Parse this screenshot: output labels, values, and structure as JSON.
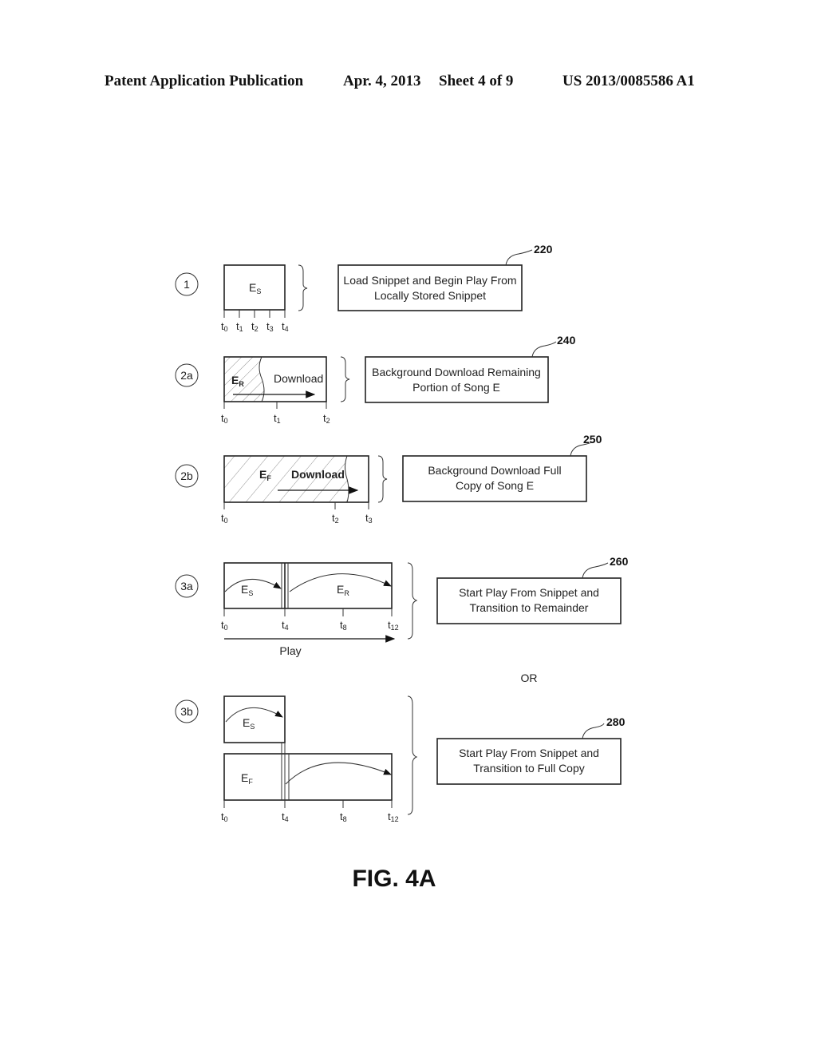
{
  "header": {
    "publication": "Patent Application Publication",
    "date": "Apr. 4, 2013",
    "sheet": "Sheet 4 of 9",
    "number": "US 2013/0085586 A1"
  },
  "figure_label": "FIG. 4A",
  "or_label": "OR",
  "steps": [
    {
      "id": "1",
      "segment_label": "E",
      "segment_sub": "S",
      "ticks": [
        {
          "t": "t",
          "s": "0"
        },
        {
          "t": "t",
          "s": "1"
        },
        {
          "t": "t",
          "s": "2"
        },
        {
          "t": "t",
          "s": "3"
        },
        {
          "t": "t",
          "s": "4"
        }
      ],
      "ref": "220",
      "description_lines": [
        "Load Snippet and Begin Play From",
        "Locally Stored Snippet"
      ]
    },
    {
      "id": "2a",
      "segment_label": "E",
      "segment_sub": "R",
      "action_label": "Download",
      "ticks": [
        {
          "t": "t",
          "s": "0"
        },
        {
          "t": "t",
          "s": "1"
        },
        {
          "t": "t",
          "s": "2"
        }
      ],
      "ref": "240",
      "description_lines": [
        "Background Download Remaining",
        "Portion of Song E"
      ]
    },
    {
      "id": "2b",
      "segment_label": "E",
      "segment_sub": "F",
      "action_label": "Download",
      "ticks": [
        {
          "t": "t",
          "s": "0"
        },
        {
          "t": "t",
          "s": "2"
        },
        {
          "t": "t",
          "s": "3"
        }
      ],
      "ref": "250",
      "description_lines": [
        "Background Download Full",
        "Copy of Song E"
      ]
    },
    {
      "id": "3a",
      "segments": [
        {
          "label": "E",
          "sub": "S"
        },
        {
          "label": "E",
          "sub": "R"
        }
      ],
      "ticks": [
        {
          "t": "t",
          "s": "0"
        },
        {
          "t": "t",
          "s": "4"
        },
        {
          "t": "t",
          "s": "8"
        },
        {
          "t": "t",
          "s": "12"
        }
      ],
      "play_label": "Play",
      "ref": "260",
      "description_lines": [
        "Start Play From Snippet and",
        "Transition to Remainder"
      ]
    },
    {
      "id": "3b",
      "segments": [
        {
          "label": "E",
          "sub": "S"
        },
        {
          "label": "E",
          "sub": "F"
        }
      ],
      "ticks": [
        {
          "t": "t",
          "s": "0"
        },
        {
          "t": "t",
          "s": "4"
        },
        {
          "t": "t",
          "s": "8"
        },
        {
          "t": "t",
          "s": "12"
        }
      ],
      "ref": "280",
      "description_lines": [
        "Start Play From Snippet and",
        "Transition to Full Copy"
      ]
    }
  ]
}
